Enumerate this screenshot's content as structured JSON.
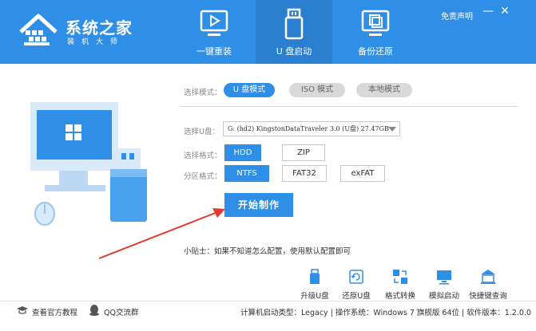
{
  "header": {
    "logo_title": "系统之家",
    "logo_subtitle": "装机大师",
    "tabs": [
      {
        "label": "一键重装",
        "icon": "play-window-icon"
      },
      {
        "label": "U 盘启动",
        "icon": "usb-drive-icon"
      },
      {
        "label": "备份还原",
        "icon": "backup-copy-icon"
      }
    ],
    "disclaimer": "免责声明",
    "minimize": "—",
    "close": "✕"
  },
  "mode": {
    "label": "选择模式：",
    "options": [
      "U 盘模式",
      "ISO 模式",
      "本地模式"
    ],
    "selected": "U 盘模式"
  },
  "usb": {
    "label": "选择U盘：",
    "value": "G: (hd2) KingstonDataTraveler 3.0 (U盘) 27.47GB"
  },
  "format": {
    "label": "选择格式：",
    "options": [
      "HDD",
      "ZIP"
    ],
    "selected": "HDD"
  },
  "partition": {
    "label": "分区格式：",
    "options": [
      "NTFS",
      "FAT32",
      "exFAT"
    ],
    "selected": "NTFS"
  },
  "start_button": "开始制作",
  "tip": "小贴士：如果不知道怎么配置，使用默认配置即可",
  "tools": [
    {
      "label": "升级U盘",
      "icon": "usb-upgrade-icon"
    },
    {
      "label": "还原U盘",
      "icon": "usb-restore-icon"
    },
    {
      "label": "格式转换",
      "icon": "format-convert-icon"
    },
    {
      "label": "模拟启动",
      "icon": "monitor-simulate-icon"
    },
    {
      "label": "快捷键查询",
      "icon": "shortcut-query-icon"
    }
  ],
  "footer": {
    "tutorial": "查看官方教程",
    "qq_group": "QQ交流群",
    "status": "计算机启动类型：Legacy | 操作系统：Windows 7 旗舰版 64位 | 软件版本：1.2.0.0"
  },
  "colors": {
    "header": "#2f8fe6",
    "accent": "#2f8fe6",
    "arrow": "#e03a2f"
  }
}
